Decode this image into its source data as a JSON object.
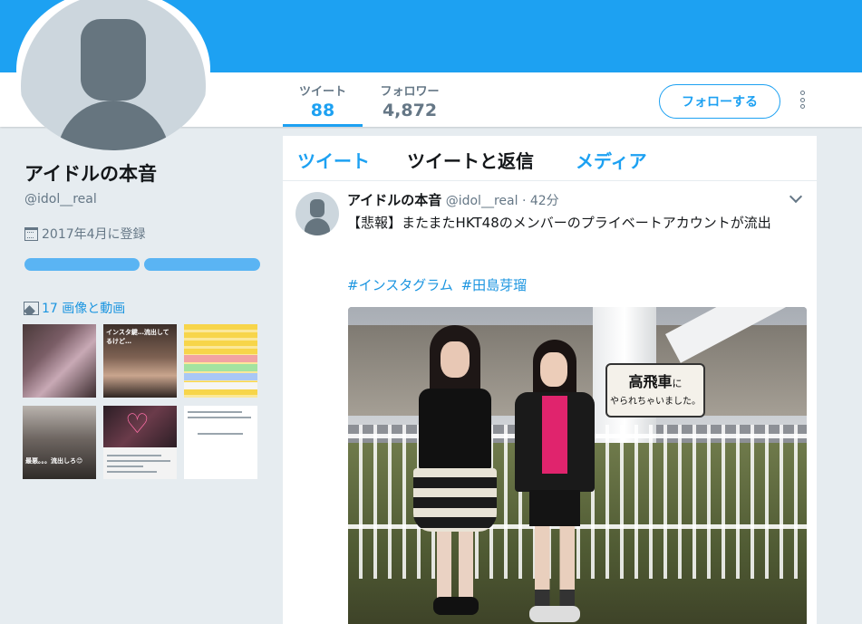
{
  "profile": {
    "name": "アイドルの本音",
    "handle": "@idol__real",
    "joined": "2017年4月に登録",
    "media_link": "17 画像と動画"
  },
  "stats": {
    "tweets_label": "ツイート",
    "tweets_value": "88",
    "followers_label": "フォロワー",
    "followers_value": "4,872"
  },
  "actions": {
    "follow_label": "フォローする"
  },
  "tabs": [
    {
      "label": "ツイート",
      "active": true
    },
    {
      "label": "ツイートと返信",
      "active": false
    },
    {
      "label": "メディア",
      "active": false
    }
  ],
  "thumbnails": [
    {
      "caption": ""
    },
    {
      "caption": "インスタ鍵…流出してるけど…"
    },
    {
      "caption": ""
    },
    {
      "caption": "最悪。。。流出しろ😊"
    },
    {
      "caption": ""
    },
    {
      "caption": ""
    }
  ],
  "tweet": {
    "name": "アイドルの本音",
    "handle": "@idol__real",
    "separator": "·",
    "time": "42分",
    "text": "【悲報】またまたHKT48のメンバーのプライベートアカウントが流出",
    "hashtags": [
      "#インスタグラム",
      "#田島芽瑠"
    ],
    "photo_sign_line1": "高飛車",
    "photo_sign_line1_small": "に",
    "photo_sign_line2": "やられちゃいました。"
  },
  "colors": {
    "brand": "#1da1f2",
    "background": "#e6ecf0",
    "text_secondary": "#657786"
  },
  "icons": [
    "more-icon",
    "calendar-icon",
    "image-icon",
    "chevron-down-icon",
    "default-avatar-icon"
  ]
}
